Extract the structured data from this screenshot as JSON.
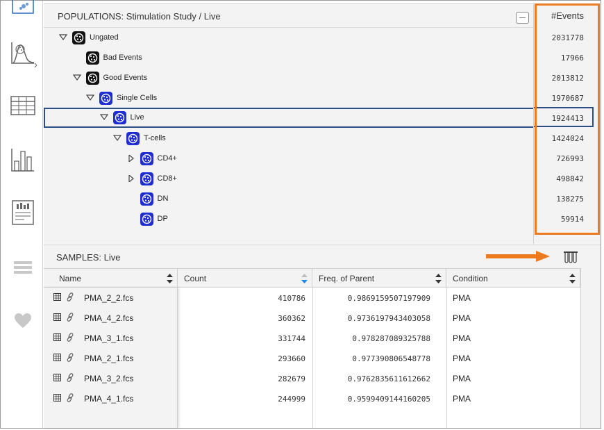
{
  "populations": {
    "title": "POPULATIONS: Stimulation Study / Live",
    "events_header": "#Events",
    "rows": [
      {
        "label": "Ungated",
        "events": "2031778",
        "icon": "gate-black-icon",
        "caret": "expanded"
      },
      {
        "label": "Bad Events",
        "events": "17966",
        "icon": "gate-black-icon",
        "caret": "none"
      },
      {
        "label": "Good Events",
        "events": "2013812",
        "icon": "gate-black-icon",
        "caret": "expanded"
      },
      {
        "label": "Single Cells",
        "events": "1970687",
        "icon": "gate-blue-icon",
        "caret": "expanded"
      },
      {
        "label": "Live",
        "events": "1924413",
        "icon": "gate-blue-icon",
        "caret": "expanded",
        "selected": true
      },
      {
        "label": "T-cells",
        "events": "1424024",
        "icon": "gate-blue-icon",
        "caret": "expanded"
      },
      {
        "label": "CD4+",
        "events": "726993",
        "icon": "gate-blue-icon",
        "caret": "collapsed"
      },
      {
        "label": "CD8+",
        "events": "498842",
        "icon": "gate-blue-icon",
        "caret": "collapsed"
      },
      {
        "label": "DN",
        "events": "138275",
        "icon": "gate-blue-icon",
        "caret": "none"
      },
      {
        "label": "DP",
        "events": "59914",
        "icon": "gate-blue-icon",
        "caret": "none"
      }
    ]
  },
  "samples": {
    "title": "SAMPLES: Live",
    "columns": [
      "Name",
      "Count",
      "Freq. of Parent",
      "Condition"
    ],
    "rows": [
      {
        "name": "PMA_2_2.fcs",
        "count": "410786",
        "freq": "0.9869159507197909",
        "condition": "PMA"
      },
      {
        "name": "PMA_4_2.fcs",
        "count": "360362",
        "freq": "0.9736197943403058",
        "condition": "PMA"
      },
      {
        "name": "PMA_3_1.fcs",
        "count": "331744",
        "freq": "0.978287089325788",
        "condition": "PMA"
      },
      {
        "name": "PMA_2_1.fcs",
        "count": "293660",
        "freq": "0.977390806548778",
        "condition": "PMA"
      },
      {
        "name": "PMA_3_2.fcs",
        "count": "282679",
        "freq": "0.9762835611612662",
        "condition": "PMA"
      },
      {
        "name": "PMA_4_1.fcs",
        "count": "244999",
        "freq": "0.9599409144160205",
        "condition": "PMA"
      }
    ]
  },
  "colors": {
    "highlight_orange": "#ec7a1f",
    "gate_blue": "#1f2ed0",
    "selection_border": "#2d4f86",
    "sort_active": "#1e88e5"
  },
  "rail_icons": [
    "scatter-plot-icon",
    "histogram-icon",
    "table-icon",
    "bar-chart-icon",
    "report-icon",
    "layers-icon",
    "heart-icon"
  ]
}
